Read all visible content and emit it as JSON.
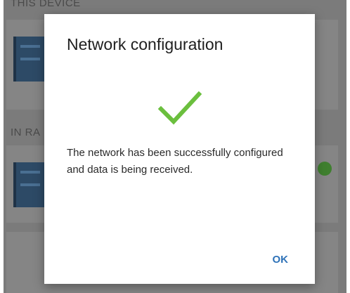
{
  "background": {
    "section_this_device": "THIS DEVICE",
    "section_in_range": "IN RA"
  },
  "dialog": {
    "title": "Network configuration",
    "icon": "check-icon",
    "icon_color": "#6bbf3e",
    "message": "The network has been successfully configured and data is being received.",
    "ok_label": "OK",
    "accent_color": "#2e72b8"
  }
}
